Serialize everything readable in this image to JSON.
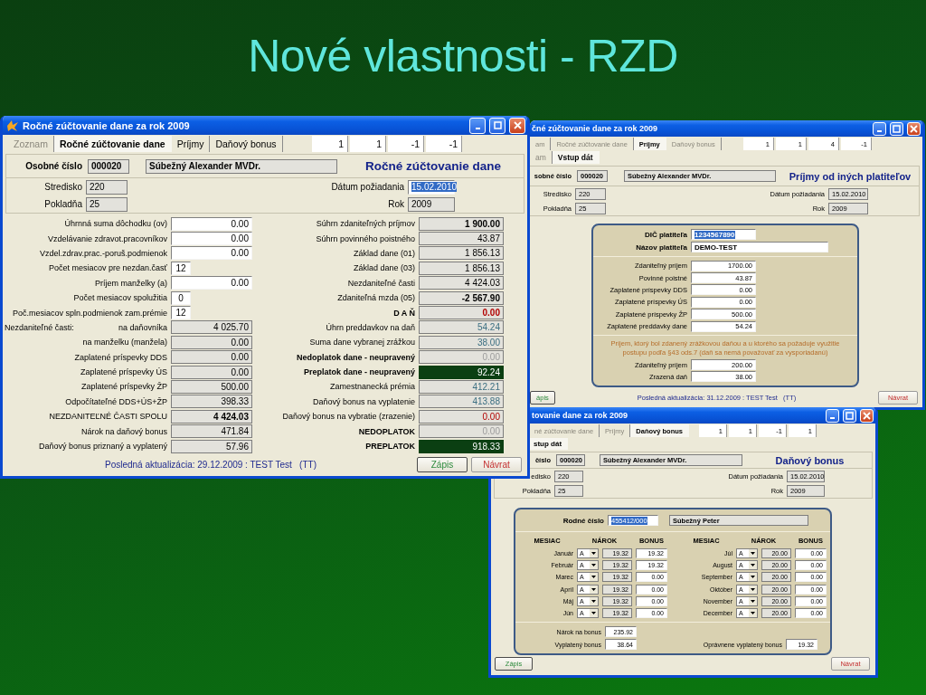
{
  "slide_title": "Nové vlastnosti - RZD",
  "annual": {
    "title": "Ročné zúčtovanie dane za rok 2009",
    "has_icon": true,
    "tabs": [
      {
        "label": "Zoznam",
        "selected": false,
        "disabled": true
      },
      {
        "label": "Ročné zúčtovanie dane",
        "selected": true,
        "disabled": false
      },
      {
        "label": "Príjmy",
        "selected": false,
        "disabled": false
      },
      {
        "label": "Daňový bonus",
        "selected": false,
        "disabled": false
      }
    ],
    "counters": [
      "1",
      "1",
      "-1",
      "-1"
    ],
    "header": {
      "id_label": "Osobné číslo",
      "id_value": "000020",
      "name": "Súbežný Alexander MVDr.",
      "heading": "Ročné zúčtovanie dane",
      "left": [
        {
          "label": "Stredisko",
          "value": "220"
        },
        {
          "label": "Pokladňa",
          "value": "25"
        }
      ],
      "right": [
        {
          "label": "Dátum požiadania",
          "value": "15.02.2010",
          "selected": true
        },
        {
          "label": "Rok",
          "value": "2009",
          "selected": false
        }
      ]
    },
    "left_rows": [
      {
        "label": "Úhrnná suma dôchodku (ov)",
        "value": "0.00",
        "kind": "input",
        "label_bold": false,
        "value_bold": false
      },
      {
        "label": "Vzdelávanie zdravot.pracovníkov",
        "value": "0.00",
        "kind": "input",
        "label_bold": false,
        "value_bold": false
      },
      {
        "label": "Vzdel.zdrav.prac.-poruš.podmienok",
        "value": "0.00",
        "kind": "input",
        "label_bold": false,
        "value_bold": false
      },
      {
        "label": "Počet mesiacov pre nezdan.časť",
        "value": "12",
        "kind": "count",
        "label_bold": false,
        "value_bold": false
      },
      {
        "label": "Príjem manželky (a)",
        "value": "0.00",
        "kind": "input",
        "label_bold": false,
        "value_bold": false
      },
      {
        "label": "Počet mesiacov spolužitia",
        "value": "0",
        "kind": "count",
        "label_bold": false,
        "value_bold": false
      },
      {
        "label": "Poč.mesiacov spln.podmienok zam.prémie",
        "value": "12",
        "kind": "count",
        "label_bold": false,
        "value_bold": false
      },
      {
        "prefix": "Nezdaniteľné časti:",
        "label": "na daňovníka",
        "value": "4 025.70",
        "kind": "readonly",
        "label_bold": false,
        "value_bold": false
      },
      {
        "label": "na manželku (manžela)",
        "value": "0.00",
        "kind": "readonly",
        "label_bold": false,
        "value_bold": false
      },
      {
        "label": "Zaplatené príspevky DDS",
        "value": "0.00",
        "kind": "readonly",
        "label_bold": false,
        "value_bold": false
      },
      {
        "label": "Zaplatené príspevky ÚS",
        "value": "0.00",
        "kind": "readonly",
        "label_bold": false,
        "value_bold": false
      },
      {
        "label": "Zaplatené príspevky ŽP",
        "value": "500.00",
        "kind": "readonly",
        "label_bold": false,
        "value_bold": false
      },
      {
        "label": "Odpočítateľné DDS+ÚS+ŽP",
        "value": "398.33",
        "kind": "readonly",
        "label_bold": false,
        "value_bold": false
      },
      {
        "label": "NEZDANITEĽNÉ ČASTI SPOLU",
        "value": "4 424.03",
        "kind": "readonly",
        "label_bold": false,
        "value_bold": true
      },
      {
        "label": "Nárok na daňový bonus",
        "value": "471.84",
        "kind": "readonly",
        "label_bold": false,
        "value_bold": false
      },
      {
        "label": "Daňový bonus priznaný a vyplatený",
        "value": "57.96",
        "kind": "readonly",
        "label_bold": false,
        "value_bold": false
      }
    ],
    "right_rows": [
      {
        "label": "Súhrn zdaniteľných príjmov",
        "value": "1 900.00",
        "kind": "readonly",
        "label_bold": false,
        "value_bold": true
      },
      {
        "label": "Súhrn povinného poistného",
        "value": "43.87",
        "kind": "readonly",
        "label_bold": false,
        "value_bold": false
      },
      {
        "label": "Základ dane (01)",
        "value": "1 856.13",
        "kind": "readonly",
        "label_bold": false,
        "value_bold": false
      },
      {
        "label": "Základ dane (03)",
        "value": "1 856.13",
        "kind": "readonly",
        "label_bold": false,
        "value_bold": false
      },
      {
        "label": "Nezdaniteľné časti",
        "value": "4 424.03",
        "kind": "readonly",
        "label_bold": false,
        "value_bold": false
      },
      {
        "label": "Zdaniteľná mzda (05)",
        "value": "-2 567.90",
        "kind": "readonly",
        "label_bold": false,
        "value_bold": true
      },
      {
        "label": "D A Ň",
        "value": "0.00",
        "kind": "red",
        "label_bold": true,
        "value_bold": true
      },
      {
        "label": "Úhrn preddavkov na daň",
        "value": "54.24",
        "kind": "teal",
        "label_bold": false,
        "value_bold": false
      },
      {
        "label": "Suma dane vybranej zrážkou",
        "value": "38.00",
        "kind": "teal",
        "label_bold": false,
        "value_bold": false
      },
      {
        "label": "Nedoplatok dane - neupravený",
        "value": "0.00",
        "kind": "faint",
        "label_bold": true,
        "value_bold": false
      },
      {
        "label": "Preplatok dane - neupravený",
        "value": "92.24",
        "kind": "highlight",
        "label_bold": true,
        "value_bold": false
      },
      {
        "label": "Zamestnanecká prémia",
        "value": "412.21",
        "kind": "teal",
        "label_bold": false,
        "value_bold": false
      },
      {
        "label": "Daňový bonus na vyplatenie",
        "value": "413.88",
        "kind": "teal",
        "label_bold": false,
        "value_bold": false
      },
      {
        "label": "Daňový bonus na vybratie (zrazenie)",
        "value": "0.00",
        "kind": "red",
        "label_bold": false,
        "value_bold": false
      },
      {
        "label": "NEDOPLATOK",
        "value": "0.00",
        "kind": "faint",
        "label_bold": true,
        "value_bold": false
      },
      {
        "label": "PREPLATOK",
        "value": "918.33",
        "kind": "highlight",
        "label_bold": true,
        "value_bold": false
      }
    ],
    "footer": {
      "note": "Posledná aktualizácia: 29.12.2009 : TEST Test   (TT)",
      "buttons": [
        {
          "label": "Zápis",
          "kind": "save"
        },
        {
          "label": "Návrat",
          "kind": "back"
        }
      ]
    }
  },
  "income": {
    "title": "čné zúčtovanie dane za rok 2009",
    "has_icon": false,
    "tabs": [
      {
        "label": "am",
        "selected": false,
        "disabled": true
      },
      {
        "label": "Ročné zúčtovanie dane",
        "selected": false,
        "disabled": true
      },
      {
        "label": "Príjmy",
        "selected": true,
        "disabled": false
      },
      {
        "label": "Daňový bonus",
        "selected": false,
        "disabled": true
      }
    ],
    "counters": [
      "1",
      "1",
      "4",
      "-1"
    ],
    "subtabs": [
      {
        "label": "am",
        "selected": false,
        "disabled": true
      },
      {
        "label": "Vstup dát",
        "selected": true,
        "disabled": false
      }
    ],
    "header": {
      "id_label": "sobné číslo",
      "id_value": "000020",
      "name": "Súbežný Alexander MVDr.",
      "heading": "Príjmy od iných platiteľov",
      "left": [
        {
          "label": "Stredisko",
          "value": "220"
        },
        {
          "label": "Pokladňa",
          "value": "25"
        }
      ],
      "right": [
        {
          "label": "Dátum požiadania",
          "value": "15.02.2010",
          "selected": false
        },
        {
          "label": "Rok",
          "value": "2009",
          "selected": false
        }
      ]
    },
    "payer": [
      {
        "label": "DIČ platiteľa",
        "value": "1234567890",
        "selected": true,
        "kind": "short"
      },
      {
        "label": "Názov platiteľa",
        "value": "DEMO-TEST",
        "selected": false,
        "kind": "wide"
      }
    ],
    "rows": [
      {
        "label": "Zdaniteľný príjem",
        "value": "1700.00"
      },
      {
        "label": "Povinné poistné",
        "value": "43.87"
      },
      {
        "label": "Zaplatené príspevky DDS",
        "value": "0.00"
      },
      {
        "label": "Zaplatené príspevky ÚS",
        "value": "0.00"
      },
      {
        "label": "Zaplatené príspevky ŽP",
        "value": "500.00"
      },
      {
        "label": "Zaplatené preddavky dane",
        "value": "54.24"
      }
    ],
    "note": "Príjem, ktorý bol zdanený zrážkovou daňou a u ktorého sa požaduje využitie postupu podľa §43 ods.7  (daň sa nemá považovať za vysporiadanú)",
    "withheld_rows": [
      {
        "label": "Zdaniteľný príjem",
        "value": "200.00"
      },
      {
        "label": "Zrazená daň",
        "value": "38.00"
      }
    ],
    "footer": {
      "note": "Posledná aktualizácia: 31.12.2009 : TEST Test   (TT)",
      "buttons": [
        {
          "label": "ápis",
          "kind": "save"
        },
        {
          "label": "Návrat",
          "kind": "back"
        }
      ]
    }
  },
  "bonus": {
    "title": "tovanie dane za rok 2009",
    "has_icon": false,
    "tabs": [
      {
        "label": "né zúčtovanie dane",
        "selected": false,
        "disabled": true
      },
      {
        "label": "Príjmy",
        "selected": false,
        "disabled": true
      },
      {
        "label": "Daňový bonus",
        "selected": true,
        "disabled": false
      }
    ],
    "counters": [
      "1",
      "1",
      "-1",
      "1"
    ],
    "subtabs": [
      {
        "label": "stup dát",
        "selected": true,
        "disabled": false
      }
    ],
    "header": {
      "id_label": "číslo",
      "id_value": "000020",
      "name": "Súbežný Alexander MVDr.",
      "heading": "Daňový bonus",
      "left": [
        {
          "label": "edisko",
          "value": "220"
        },
        {
          "label": "Pokladňa",
          "value": "25"
        }
      ],
      "right": [
        {
          "label": "Dátum požiadania",
          "value": "15.02.2010",
          "selected": false
        },
        {
          "label": "Rok",
          "value": "2009",
          "selected": false
        }
      ]
    },
    "child": {
      "label": "Rodné číslo",
      "value": "455412/000",
      "selected": true,
      "name": "Súbežný Peter"
    },
    "columns": [
      "MESIAC",
      "NÁROK",
      "BONUS",
      "MESIAC",
      "NÁROK",
      "BONUS"
    ],
    "months": [
      {
        "month": "Január",
        "code": "A",
        "claim": "19.32",
        "bonus": "19.32"
      },
      {
        "month": "Február",
        "code": "A",
        "claim": "19.32",
        "bonus": "19.32"
      },
      {
        "month": "Marec",
        "code": "A",
        "claim": "19.32",
        "bonus": "0.00"
      },
      {
        "month": "Apríl",
        "code": "A",
        "claim": "19.32",
        "bonus": "0.00"
      },
      {
        "month": "Máj",
        "code": "A",
        "claim": "19.32",
        "bonus": "0.00"
      },
      {
        "month": "Jún",
        "code": "A",
        "claim": "19.32",
        "bonus": "0.00"
      },
      {
        "month": "Júl",
        "code": "A",
        "claim": "20.00",
        "bonus": "0.00"
      },
      {
        "month": "August",
        "code": "A",
        "claim": "20.00",
        "bonus": "0.00"
      },
      {
        "month": "September",
        "code": "A",
        "claim": "20.00",
        "bonus": "0.00"
      },
      {
        "month": "Október",
        "code": "A",
        "claim": "20.00",
        "bonus": "0.00"
      },
      {
        "month": "November",
        "code": "A",
        "claim": "20.00",
        "bonus": "0.00"
      },
      {
        "month": "December",
        "code": "A",
        "claim": "20.00",
        "bonus": "0.00"
      }
    ],
    "summary_left": [
      {
        "label": "Nárok na bonus",
        "value": "235.92"
      },
      {
        "label": "Vyplatený bonus",
        "value": "38.64"
      }
    ],
    "summary_right": [
      {
        "label": "Oprávnene vyplatený bonus",
        "value": "19.32"
      }
    ],
    "footer": {
      "buttons": [
        {
          "label": "Zápis",
          "kind": "save"
        },
        {
          "label": "Návrat",
          "kind": "back"
        }
      ]
    }
  }
}
